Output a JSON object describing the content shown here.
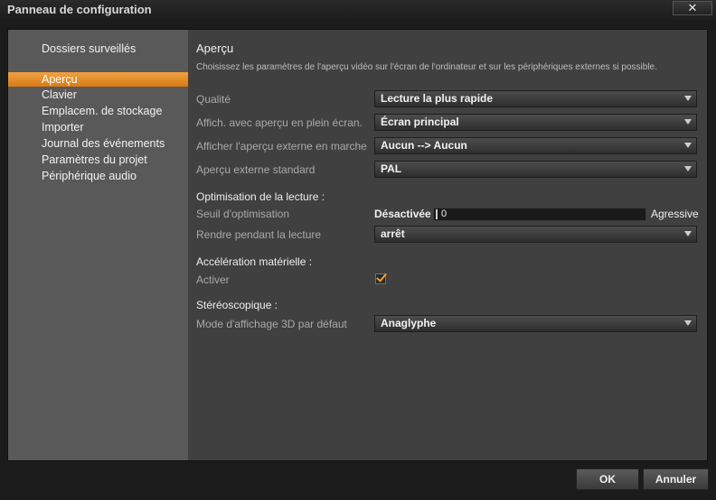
{
  "window": {
    "title": "Panneau de configuration",
    "close_glyph": "✕"
  },
  "sidebar": {
    "items": [
      {
        "label": "Dossiers surveillés"
      },
      {
        "label": "Aperçu"
      },
      {
        "label": "Clavier"
      },
      {
        "label": "Emplacem. de stockage"
      },
      {
        "label": "Importer"
      },
      {
        "label": "Journal des événements"
      },
      {
        "label": "Paramètres du projet"
      },
      {
        "label": "Périphérique audio"
      }
    ],
    "active": "Aperçu"
  },
  "main": {
    "title": "Aperçu",
    "description": "Choisissez les paramètres de l'aperçu vidéo sur l'écran de l'ordinateur et sur les périphériques externes si possible.",
    "qualite": {
      "label": "Qualité",
      "value": "Lecture la plus rapide"
    },
    "plein_ecran": {
      "label": "Affich. avec aperçu en plein écran.",
      "value": "Écran principal"
    },
    "externe_marche": {
      "label": "Afficher l'aperçu externe en marche",
      "value": "Aucun --> Aucun"
    },
    "externe_standard": {
      "label": "Aperçu externe standard",
      "value": "PAL"
    },
    "optimisation": {
      "heading": "Optimisation de la lecture :",
      "seuil_label": "Seuil d'optimisation",
      "slider_min_label": "Désactivée",
      "slider_value": "0",
      "slider_max_label": "Agressive",
      "rendre_label": "Rendre pendant la lecture",
      "rendre_value": "arrêt"
    },
    "acceleration": {
      "heading": "Accélération matérielle :",
      "activer_label": "Activer",
      "checked": true
    },
    "stereo": {
      "heading": "Stéréoscopique :",
      "mode_label": "Mode d'affichage 3D par défaut",
      "mode_value": "Anaglyphe"
    }
  },
  "footer": {
    "ok_label": "OK",
    "cancel_label": "Annuler"
  },
  "colors": {
    "accent": "#e8891e",
    "sidebar_bg": "#595959",
    "content_bg": "#404040"
  }
}
